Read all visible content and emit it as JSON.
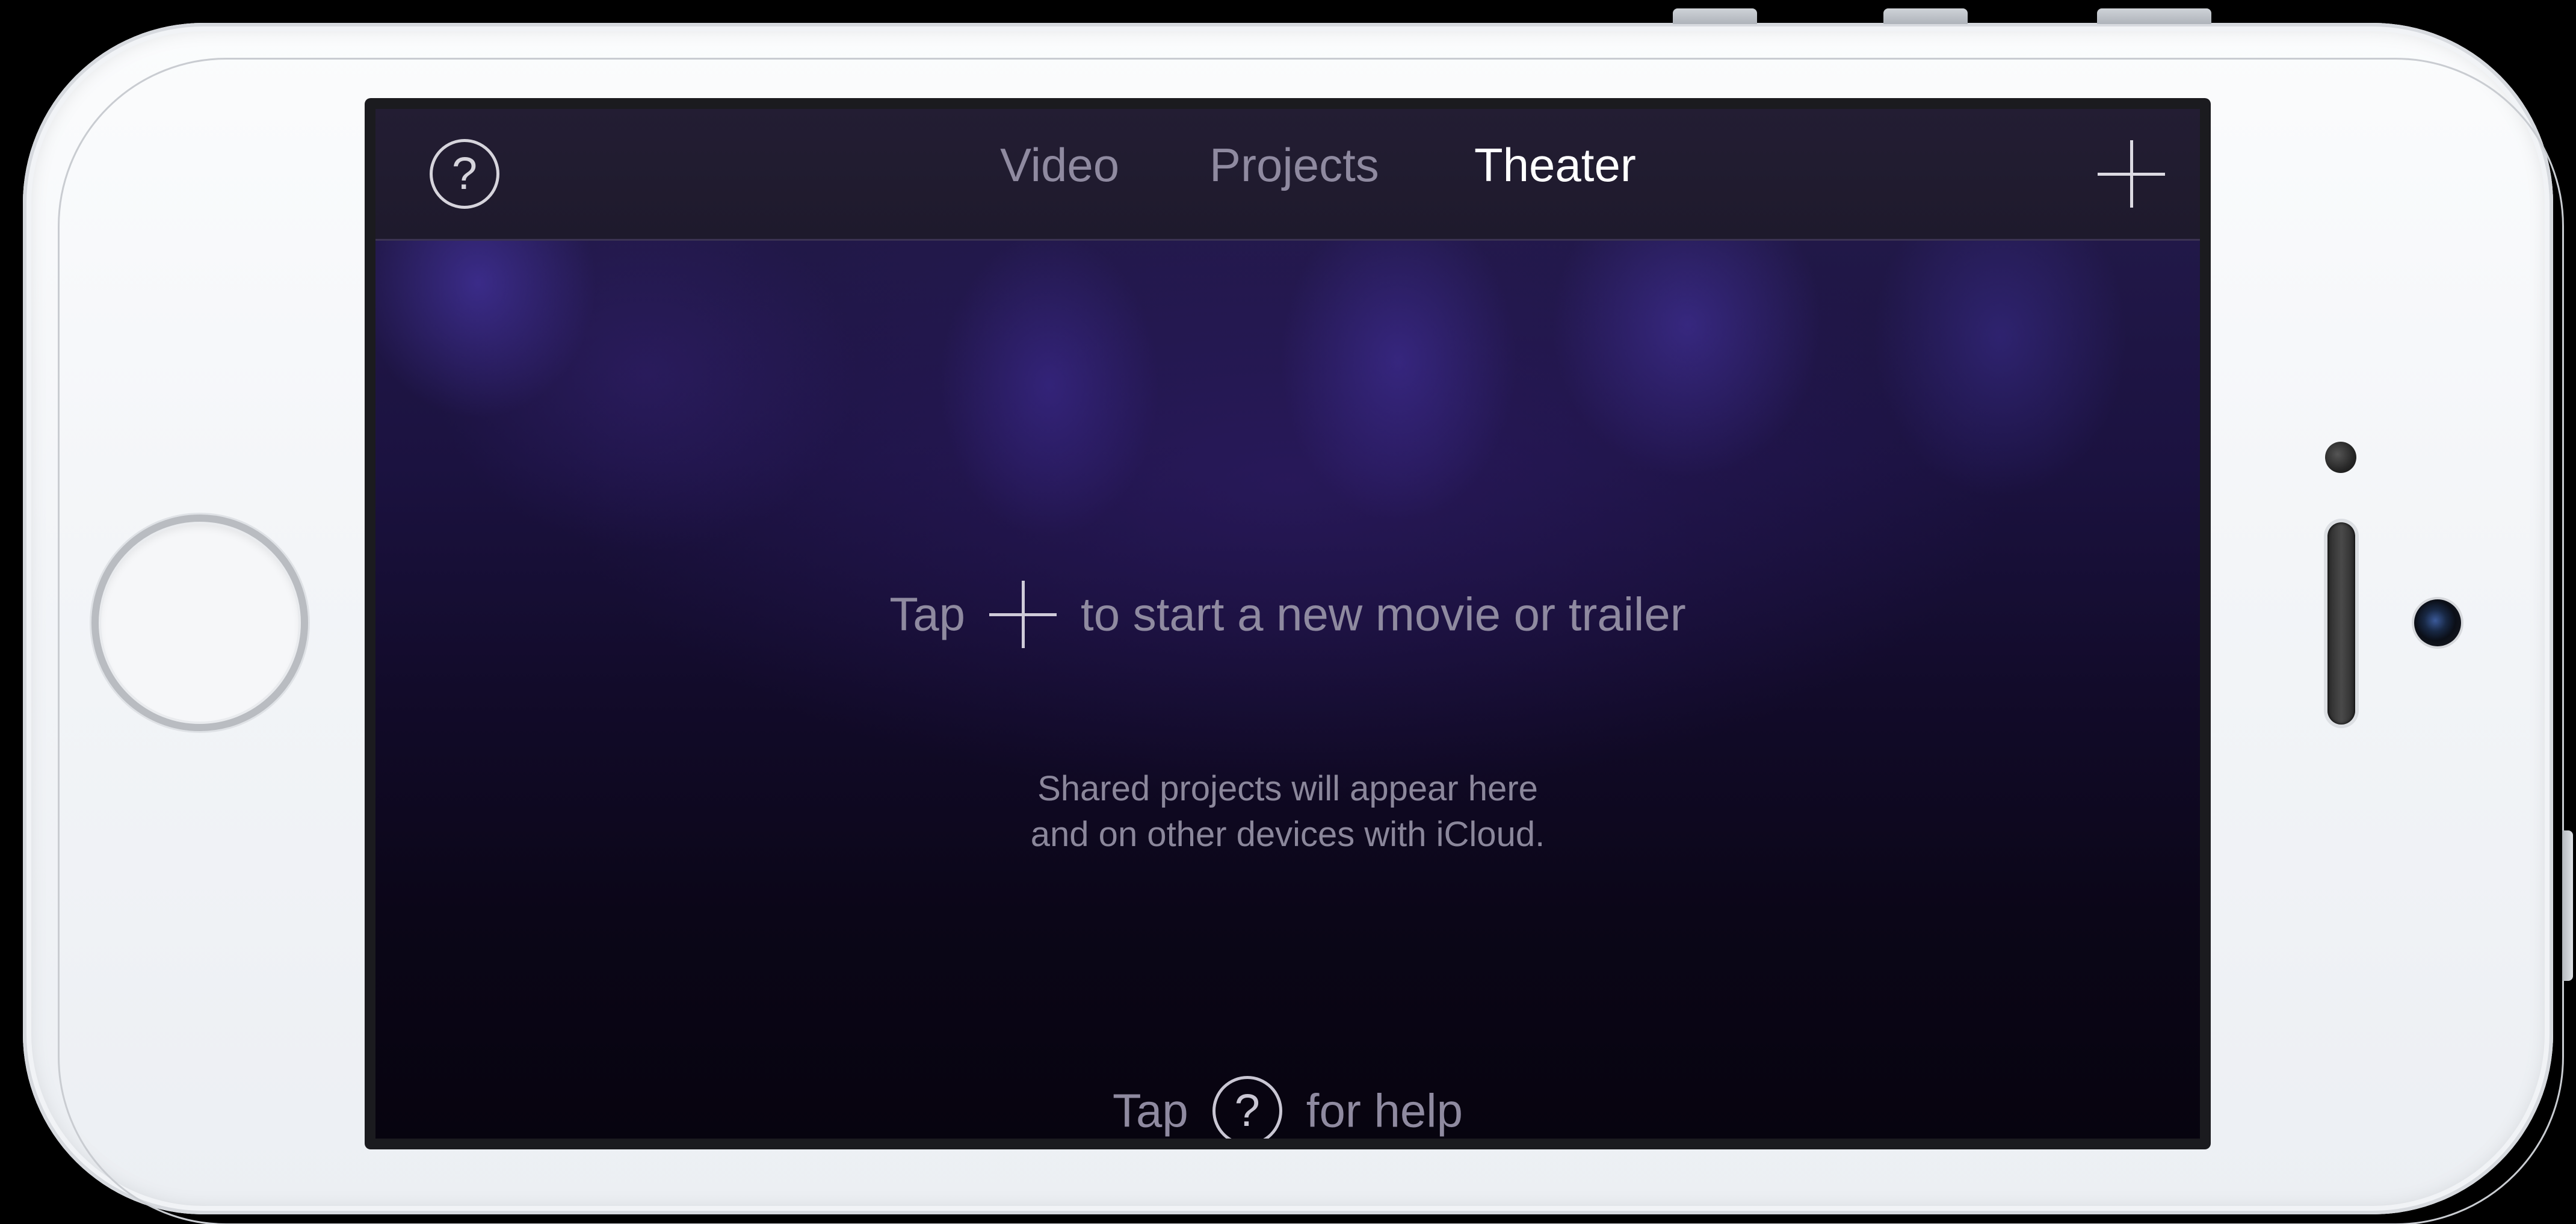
{
  "navbar": {
    "help_icon_glyph": "?",
    "tabs": [
      {
        "label": "Video"
      },
      {
        "label": "Projects"
      },
      {
        "label": "Theater"
      }
    ],
    "selected_tab": "Theater",
    "add_icon": "plus-icon"
  },
  "main": {
    "start_prefix": "Tap",
    "start_suffix": "to start a new movie or trailer",
    "shared_line1": "Shared projects will appear here",
    "shared_line2": "and on other devices with iCloud.",
    "help_prefix": "Tap",
    "help_glyph": "?",
    "help_suffix": "for help"
  },
  "colors": {
    "active_tab": "#ffffff",
    "inactive_tab": "#8f8aa0",
    "stage_background": "#120b2a",
    "device_body": "#f3f5f8"
  }
}
